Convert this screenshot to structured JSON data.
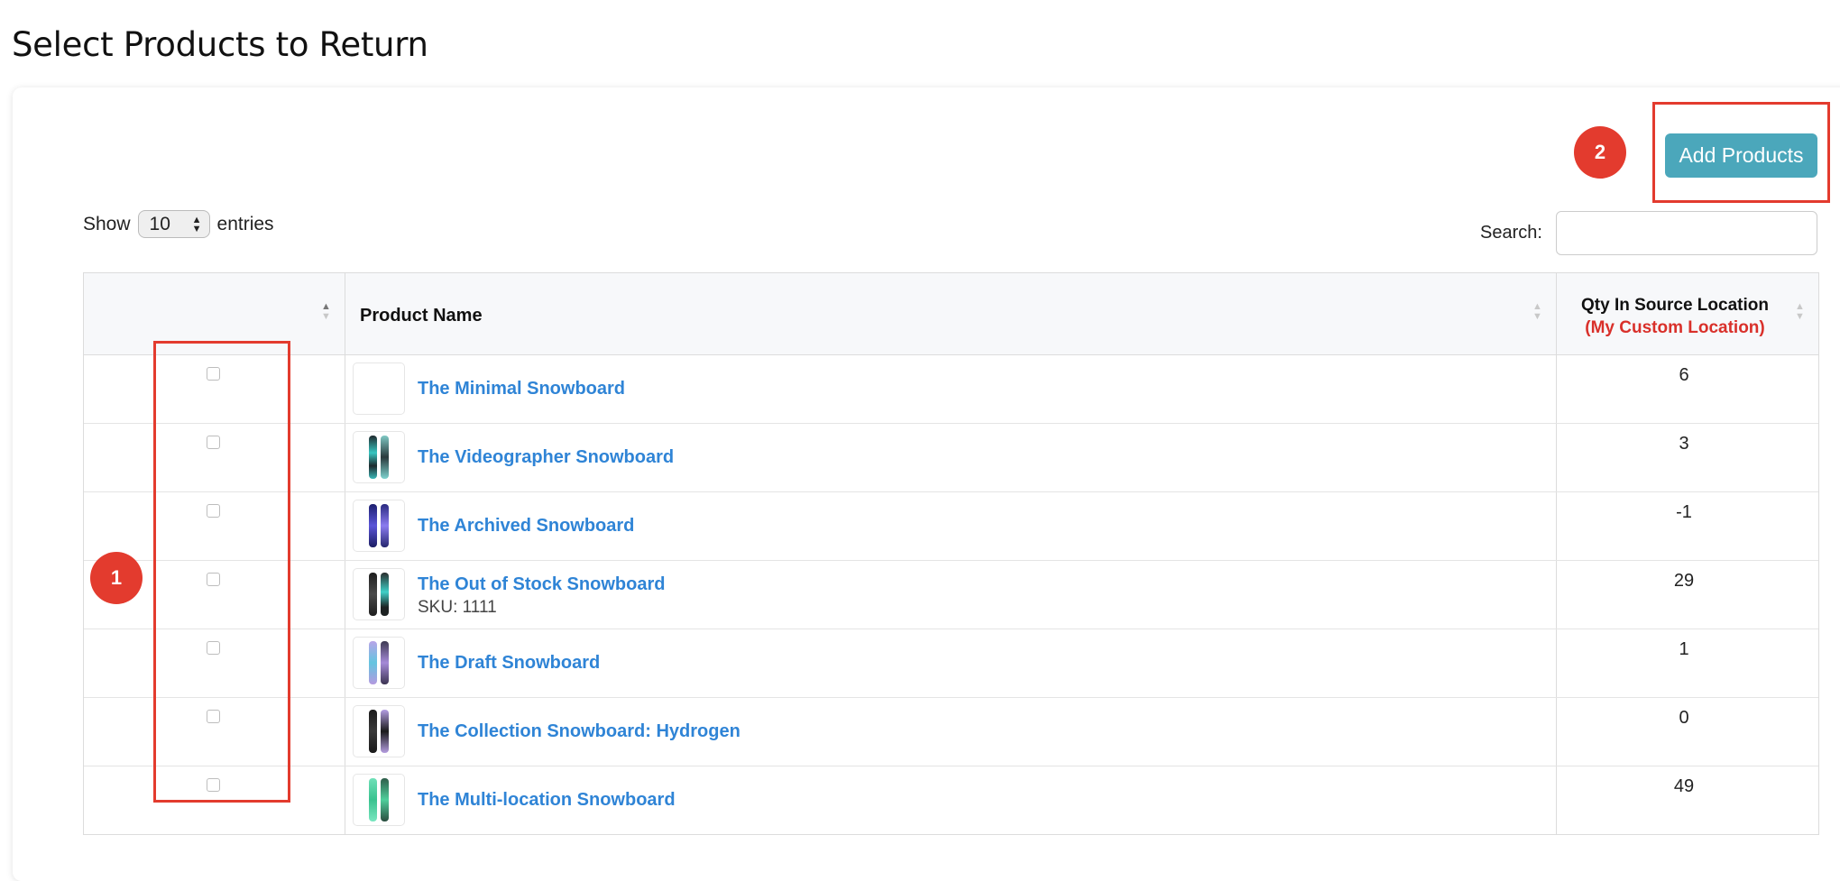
{
  "page": {
    "title": "Select Products to Return"
  },
  "toolbar": {
    "add_products_label": "Add Products"
  },
  "markers": {
    "one": "1",
    "two": "2"
  },
  "length_control": {
    "show_label": "Show",
    "value": "10",
    "entries_label": "entries"
  },
  "search": {
    "label": "Search:",
    "value": ""
  },
  "table": {
    "headers": {
      "product_name": "Product Name",
      "qty_title": "Qty In Source Location",
      "qty_location": "(My Custom Location)"
    },
    "rows": [
      {
        "name": "The Minimal Snowboard",
        "sku": "",
        "qty": "6",
        "checked": false
      },
      {
        "name": "The Videographer Snowboard",
        "sku": "",
        "qty": "3",
        "checked": false
      },
      {
        "name": "The Archived Snowboard",
        "sku": "",
        "qty": "-1",
        "checked": false
      },
      {
        "name": "The Out of Stock Snowboard",
        "sku": "SKU: 1111",
        "qty": "29",
        "checked": false
      },
      {
        "name": "The Draft Snowboard",
        "sku": "",
        "qty": "1",
        "checked": false
      },
      {
        "name": "The Collection Snowboard: Hydrogen",
        "sku": "",
        "qty": "0",
        "checked": false
      },
      {
        "name": "The Multi-location Snowboard",
        "sku": "",
        "qty": "49",
        "checked": false
      }
    ]
  },
  "colors": {
    "accent_button": "#4ba7bb",
    "highlight": "#e33b2e",
    "link": "#2f84d6",
    "location_text": "#d9302a"
  }
}
